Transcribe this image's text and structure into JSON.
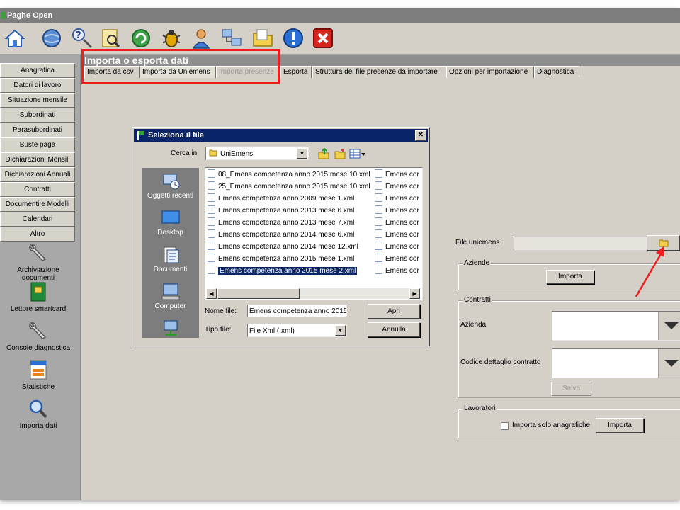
{
  "app": {
    "title": "Paghe Open"
  },
  "toolbar": {
    "icons": [
      "home-icon",
      "network-icon",
      "help-icon",
      "search-document-icon",
      "refresh-icon",
      "bug-icon",
      "user-icon",
      "computer-network-icon",
      "folder-icon",
      "info-icon",
      "close-app-icon"
    ]
  },
  "sidebar": {
    "items": [
      {
        "label": "Anagrafica"
      },
      {
        "label": "Datori di lavoro"
      },
      {
        "label": "Situazione mensile"
      },
      {
        "label": "Subordinati"
      },
      {
        "label": "Parasubordinati"
      },
      {
        "label": "Buste paga"
      },
      {
        "label": "Dichiarazioni Mensili"
      },
      {
        "label": "Dichiarazioni Annuali"
      },
      {
        "label": "Contratti"
      },
      {
        "label": "Documenti e Modelli"
      },
      {
        "label": "Calendari"
      },
      {
        "label": "Altro"
      }
    ],
    "tools": [
      {
        "label": "Archiviazione documenti",
        "icon": "wrench-icon"
      },
      {
        "label": "Lettore smartcard",
        "icon": "smartcard-icon"
      },
      {
        "label": "Console diagnostica",
        "icon": "wrench-icon"
      },
      {
        "label": "Statistiche",
        "icon": "statistics-icon"
      },
      {
        "label": "Importa dati",
        "icon": "magnifier-icon"
      }
    ]
  },
  "main": {
    "title": "Importa o esporta dati",
    "tabs": [
      {
        "label": "Importa da csv"
      },
      {
        "label": "Importa da Uniemens"
      },
      {
        "label": "Importa presenze"
      },
      {
        "label": "Esporta"
      },
      {
        "label": "Struttura del file presenze da importare"
      },
      {
        "label": "Opzioni per importazione"
      },
      {
        "label": "Diagnostica"
      }
    ]
  },
  "dialog": {
    "title": "Seleziona il file",
    "close": "✕",
    "look_in_label": "Cerca in:",
    "look_in_value": "UniEmens",
    "places": [
      "Oggetti recenti",
      "Desktop",
      "Documenti",
      "Computer"
    ],
    "files_col1": [
      "08_Emens competenza anno 2015 mese 10.xml",
      "25_Emens competenza anno 2015 mese 10.xml",
      "Emens competenza anno 2009 mese 1.xml",
      "Emens competenza anno 2013 mese 6.xml",
      "Emens competenza anno 2013 mese 7.xml",
      "Emens competenza anno 2014 mese 6.xml",
      "Emens competenza anno 2014 mese 12.xml",
      "Emens competenza anno 2015 mese 1.xml",
      "Emens competenza anno 2015 mese 2.xml"
    ],
    "files_col2": [
      "Emens cor",
      "Emens cor",
      "Emens cor",
      "Emens cor",
      "Emens cor",
      "Emens cor",
      "Emens cor",
      "Emens cor",
      "Emens cor"
    ],
    "selected_file": "Emens competenza anno 2015 mese 2.xml",
    "filename_label": "Nome file:",
    "filename_value": "Emens competenza anno 2015",
    "filetype_label": "Tipo file:",
    "filetype_value": "File Xml (.xml)",
    "open_button": "Apri",
    "cancel_button": "Annulla"
  },
  "panel": {
    "file_label": "File uniemens",
    "file_value": "",
    "aziende": {
      "legend": "Aziende",
      "button": "Importa"
    },
    "contratti": {
      "legend": "Contratti",
      "azienda_label": "Azienda",
      "codice_label": "Codice dettaglio contratto",
      "save_button": "Salva"
    },
    "lavoratori": {
      "legend": "Lavoratori",
      "checkbox_label": "Importa solo anagrafiche",
      "checked": false,
      "button": "Importa"
    }
  },
  "colors": {
    "highlight": "#ee1e1e",
    "selection": "#0a246a",
    "title_bar": "#0a246a"
  }
}
